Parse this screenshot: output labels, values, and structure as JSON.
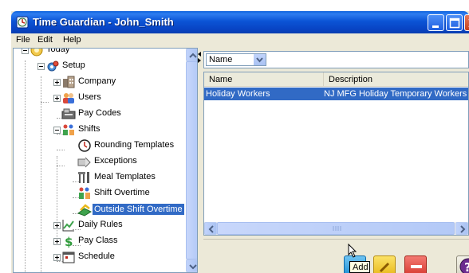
{
  "window": {
    "title": "Time Guardian - John_Smith",
    "menu": [
      "File",
      "Edit",
      "Help"
    ]
  },
  "tree": {
    "items": [
      {
        "label": "Today",
        "icon": "today-globe-icon"
      },
      {
        "label": "Setup",
        "icon": "setup-gear-icon"
      },
      {
        "label": "Company",
        "icon": "company-building-icon"
      },
      {
        "label": "Users",
        "icon": "users-icon"
      },
      {
        "label": "Pay Codes",
        "icon": "pay-codes-icon"
      },
      {
        "label": "Shifts",
        "icon": "shifts-icon"
      },
      {
        "label": "Rounding Templates",
        "icon": "clock-icon"
      },
      {
        "label": "Exceptions",
        "icon": "exceptions-icon"
      },
      {
        "label": "Meal Templates",
        "icon": "utensils-icon"
      },
      {
        "label": "Shift Overtime",
        "icon": "shift-overtime-icon"
      },
      {
        "label": "Outside Shift Overtime",
        "icon": "outside-shift-overtime-icon"
      },
      {
        "label": "Daily Rules",
        "icon": "daily-rules-chart-icon"
      },
      {
        "label": "Pay Class",
        "icon": "dollar-icon"
      },
      {
        "label": "Schedule",
        "icon": "calendar-icon"
      }
    ],
    "selected": "Outside Shift Overtime"
  },
  "filter": {
    "selected": "Name"
  },
  "grid": {
    "columns": [
      "Name",
      "Description"
    ],
    "rows": [
      {
        "name": "Holiday Workers",
        "description": "NJ MFG Holiday Temporary Workers",
        "selected": true
      }
    ]
  },
  "toolbar": {
    "tooltip": "Add"
  },
  "colors": {
    "selection": "#316ac5",
    "titlebar": "#0a5fdc",
    "add": "#1d8fd6",
    "edit": "#e9b91b",
    "delete": "#d83a30"
  }
}
